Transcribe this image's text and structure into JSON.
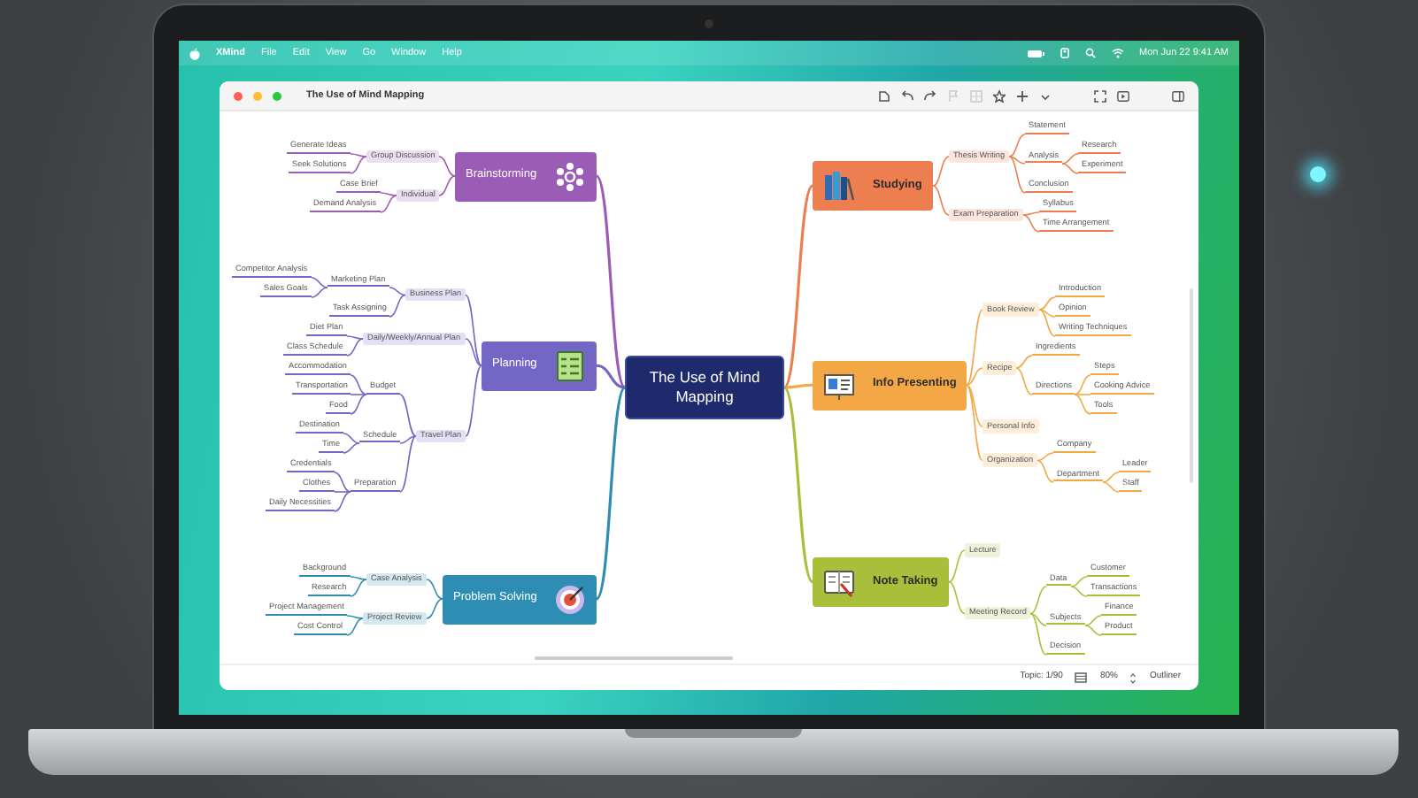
{
  "menu_bar": {
    "app": "XMind",
    "menus": [
      "File",
      "Edit",
      "View",
      "Go",
      "Window",
      "Help"
    ],
    "clock": "Mon Jun 22  9:41 AM"
  },
  "window": {
    "title": "The Use of Mind Mapping"
  },
  "mind_map": {
    "central_topic": "The Use of Mind Mapping",
    "branches": [
      {
        "label": "Brainstorming",
        "on_right": false,
        "color": "#9a5cb4",
        "children": [
          {
            "label": "Group Discussion",
            "children": [
              {
                "label": "Generate Ideas"
              },
              {
                "label": "Seek Solutions"
              }
            ]
          },
          {
            "label": "Individual",
            "children": [
              {
                "label": "Case Brief"
              },
              {
                "label": "Demand Analysis"
              }
            ]
          }
        ]
      },
      {
        "label": "Planning",
        "on_right": false,
        "color": "#7366c4",
        "children": [
          {
            "label": "Business Plan",
            "children": [
              {
                "label": "Marketing Plan",
                "children": [
                  {
                    "label": "Competitor Analysis"
                  },
                  {
                    "label": "Sales Goals"
                  }
                ]
              },
              {
                "label": "Task Assigning"
              }
            ]
          },
          {
            "label": "Daily/Weekly/Annual Plan",
            "children": [
              {
                "label": "Diet Plan"
              },
              {
                "label": "Class Schedule"
              }
            ]
          },
          {
            "label": "Travel Plan",
            "children": [
              {
                "label": "Budget",
                "children": [
                  {
                    "label": "Accommodation"
                  },
                  {
                    "label": "Transportation"
                  },
                  {
                    "label": "Food"
                  }
                ]
              },
              {
                "label": "Schedule",
                "children": [
                  {
                    "label": "Destination"
                  },
                  {
                    "label": "Time"
                  }
                ]
              },
              {
                "label": "Preparation",
                "children": [
                  {
                    "label": "Credentials"
                  },
                  {
                    "label": "Clothes"
                  },
                  {
                    "label": "Daily Necessities"
                  }
                ]
              }
            ]
          }
        ]
      },
      {
        "label": "Problem Solving",
        "on_right": false,
        "color": "#2e8db2",
        "children": [
          {
            "label": "Case Analysis",
            "children": [
              {
                "label": "Background"
              },
              {
                "label": "Research"
              }
            ]
          },
          {
            "label": "Project Review",
            "children": [
              {
                "label": "Project Management"
              },
              {
                "label": "Cost Control"
              }
            ]
          }
        ]
      },
      {
        "label": "Studying",
        "on_right": true,
        "color": "#ec7e4f",
        "children": [
          {
            "label": "Thesis Writing",
            "children": [
              {
                "label": "Statement"
              },
              {
                "label": "Analysis",
                "children": [
                  {
                    "label": "Research"
                  },
                  {
                    "label": "Experiment"
                  }
                ]
              },
              {
                "label": "Conclusion"
              }
            ]
          },
          {
            "label": "Exam Preparation",
            "children": [
              {
                "label": "Syllabus"
              },
              {
                "label": "Time Arrangement"
              }
            ]
          }
        ]
      },
      {
        "label": "Info Presenting",
        "on_right": true,
        "color": "#f3a845",
        "children": [
          {
            "label": "Book Review",
            "children": [
              {
                "label": "Introduction"
              },
              {
                "label": "Opinion"
              },
              {
                "label": "Writing Techniques"
              }
            ]
          },
          {
            "label": "Recipe",
            "children": [
              {
                "label": "Ingredients"
              },
              {
                "label": "Directions",
                "children": [
                  {
                    "label": "Steps"
                  },
                  {
                    "label": "Cooking Advice"
                  },
                  {
                    "label": "Tools"
                  }
                ]
              }
            ]
          },
          {
            "label": "Personal Info"
          },
          {
            "label": "Organization",
            "children": [
              {
                "label": "Company"
              },
              {
                "label": "Department",
                "children": [
                  {
                    "label": "Leader"
                  },
                  {
                    "label": "Staff"
                  }
                ]
              }
            ]
          }
        ]
      },
      {
        "label": "Note Taking",
        "on_right": true,
        "color": "#a9bf3b",
        "children": [
          {
            "label": "Lecture"
          },
          {
            "label": "Meeting Record",
            "children": [
              {
                "label": "Data",
                "children": [
                  {
                    "label": "Customer"
                  },
                  {
                    "label": "Transactions"
                  }
                ]
              },
              {
                "label": "Subjects",
                "children": [
                  {
                    "label": "Finance"
                  },
                  {
                    "label": "Product"
                  }
                ]
              },
              {
                "label": "Decision"
              }
            ]
          }
        ]
      }
    ]
  },
  "status_bar": {
    "topic_count": "Topic: 1/90",
    "zoom": "80%",
    "view": "Outliner"
  }
}
